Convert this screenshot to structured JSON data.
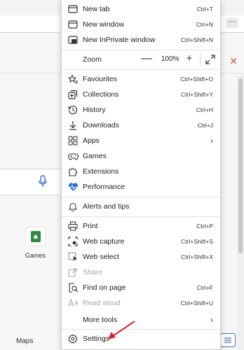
{
  "menu": {
    "items": [
      {
        "label": "New tab",
        "shortcut": "Ctrl+T"
      },
      {
        "label": "New window",
        "shortcut": "Ctrl+N"
      },
      {
        "label": "New InPrivate window",
        "shortcut": "Ctrl+Shift+N"
      },
      {
        "label": "Favourites",
        "shortcut": "Ctrl+Shift+O"
      },
      {
        "label": "Collections",
        "shortcut": "Ctrl+Shift+Y"
      },
      {
        "label": "History",
        "shortcut": "Ctrl+H"
      },
      {
        "label": "Downloads",
        "shortcut": "Ctrl+J"
      },
      {
        "label": "Apps",
        "shortcut": ""
      },
      {
        "label": "Games",
        "shortcut": ""
      },
      {
        "label": "Extensions",
        "shortcut": ""
      },
      {
        "label": "Performance",
        "shortcut": ""
      },
      {
        "label": "Alerts and tips",
        "shortcut": ""
      },
      {
        "label": "Print",
        "shortcut": "Ctrl+P"
      },
      {
        "label": "Web capture",
        "shortcut": "Ctrl+Shift+S"
      },
      {
        "label": "Web select",
        "shortcut": "Ctrl+Shift+X"
      },
      {
        "label": "Share",
        "shortcut": ""
      },
      {
        "label": "Find on page",
        "shortcut": "Ctrl+F"
      },
      {
        "label": "Read aloud",
        "shortcut": "Ctrl+Shift+U"
      },
      {
        "label": "More tools",
        "shortcut": ""
      },
      {
        "label": "Settings",
        "shortcut": ""
      }
    ],
    "zoom": {
      "label": "Zoom",
      "minus": "—",
      "value": "100%",
      "plus": "+"
    },
    "chevron": "›"
  },
  "background": {
    "more_button": "···",
    "close_glyph": "✕",
    "tile_label": "Games",
    "maps_label": "Maps"
  },
  "colors": {
    "accent_arrow": "#d9262b",
    "mic_blue": "#2d6fd0",
    "performance_blue": "#2d6fd0",
    "close_red": "#e04a3b"
  }
}
